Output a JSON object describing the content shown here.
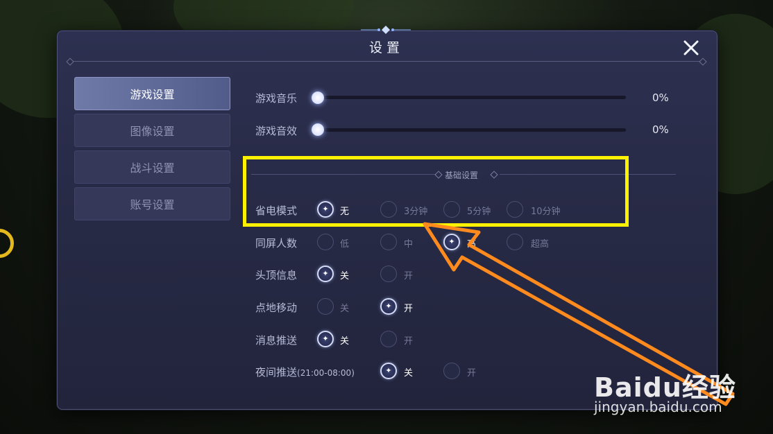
{
  "dialog": {
    "title": "设置"
  },
  "tabs": [
    {
      "label": "游戏设置",
      "active": true
    },
    {
      "label": "图像设置",
      "active": false
    },
    {
      "label": "战斗设置",
      "active": false
    },
    {
      "label": "账号设置",
      "active": false
    }
  ],
  "sliders": [
    {
      "label": "游戏音乐",
      "value_text": "0%",
      "level": 0
    },
    {
      "label": "游戏音效",
      "value_text": "0%",
      "level": 0
    }
  ],
  "section": {
    "title": "基础设置"
  },
  "settings": [
    {
      "label": "省电模式",
      "options": [
        "无",
        "3分钟",
        "5分钟",
        "10分钟"
      ],
      "selected": 0
    },
    {
      "label": "同屏人数",
      "options": [
        "低",
        "中",
        "高",
        "超高"
      ],
      "selected": 2
    },
    {
      "label": "头顶信息",
      "options": [
        "关",
        "开"
      ],
      "selected": 0
    },
    {
      "label": "点地移动",
      "options": [
        "关",
        "开"
      ],
      "selected": 1
    },
    {
      "label": "消息推送",
      "options": [
        "关",
        "开"
      ],
      "selected": 0
    },
    {
      "label": "夜间推送",
      "label_suffix": "(21:00-08:00)",
      "options": [
        "关",
        "开"
      ],
      "selected": 0
    }
  ],
  "watermark": {
    "brand": "Baidu经验",
    "url": "jingyan.baidu.com"
  },
  "colors": {
    "highlight_box": "#fff200",
    "arrow": "#ff8a1e"
  }
}
